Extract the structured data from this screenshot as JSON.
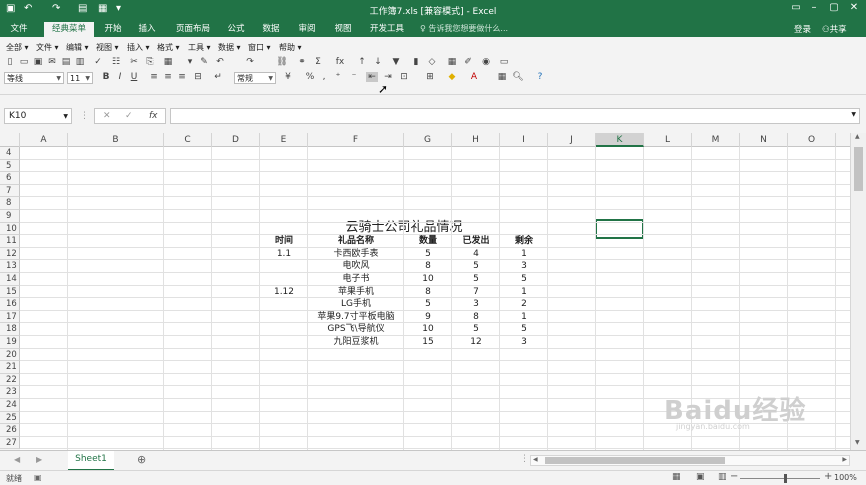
{
  "window": {
    "title": "工作簿7.xls  [兼容模式] - Excel"
  },
  "ribbon_tabs": [
    "文件",
    "经典菜单",
    "开始",
    "插入",
    "页面布局",
    "公式",
    "数据",
    "审阅",
    "视图",
    "开发工具"
  ],
  "active_tab": "经典菜单",
  "tell_me": "告诉我您想要做什么...",
  "account": {
    "login": "登录",
    "share": "共享"
  },
  "classic_menu": [
    "全部 ▾",
    "文件 ▾",
    "编辑 ▾",
    "视图 ▾",
    "插入 ▾",
    "格式 ▾",
    "工具 ▾",
    "数据 ▾",
    "窗口 ▾",
    "帮助 ▾"
  ],
  "font": {
    "name": "等线",
    "size": "11",
    "number_format": "常规"
  },
  "formula_bar": {
    "name_box": "K10",
    "fx": "fx",
    "value": ""
  },
  "columns": [
    "A",
    "B",
    "C",
    "D",
    "E",
    "F",
    "G",
    "H",
    "I",
    "J",
    "K",
    "L",
    "M",
    "N",
    "O"
  ],
  "selected_column": "K",
  "rows": [
    "4",
    "5",
    "6",
    "7",
    "8",
    "9",
    "10",
    "11",
    "12",
    "13",
    "14",
    "15",
    "16",
    "17",
    "18",
    "19",
    "20",
    "21",
    "22",
    "23",
    "24",
    "25",
    "26",
    "27"
  ],
  "sheet": {
    "title": "云骑士公司礼品情况",
    "headers": [
      "时间",
      "礼品名称",
      "数量",
      "已发出",
      "剩余"
    ],
    "records": [
      {
        "time": "1.1",
        "name": "卡西欧手表",
        "qty": "5",
        "sent": "4",
        "left": "1"
      },
      {
        "time": "",
        "name": "电吹风",
        "qty": "8",
        "sent": "5",
        "left": "3"
      },
      {
        "time": "",
        "name": "电子书",
        "qty": "10",
        "sent": "5",
        "left": "5"
      },
      {
        "time": "1.12",
        "name": "苹果手机",
        "qty": "8",
        "sent": "7",
        "left": "1"
      },
      {
        "time": "",
        "name": "LG手机",
        "qty": "5",
        "sent": "3",
        "left": "2"
      },
      {
        "time": "",
        "name": "苹果9.7寸平板电脑",
        "qty": "9",
        "sent": "8",
        "left": "1"
      },
      {
        "time": "",
        "name": "GPS飞\\导航仪",
        "qty": "10",
        "sent": "5",
        "left": "5"
      },
      {
        "time": "",
        "name": "九阳豆浆机",
        "qty": "15",
        "sent": "12",
        "left": "3"
      }
    ]
  },
  "sheet_tabs": [
    "Sheet1"
  ],
  "status": {
    "ready": "就绪",
    "zoom": "100%"
  },
  "watermark": {
    "main": "Baidu经验",
    "sub": "jingyan.baidu.com"
  },
  "colors": {
    "accent": "#217346",
    "ribbon_bg": "#f3f3f3"
  }
}
